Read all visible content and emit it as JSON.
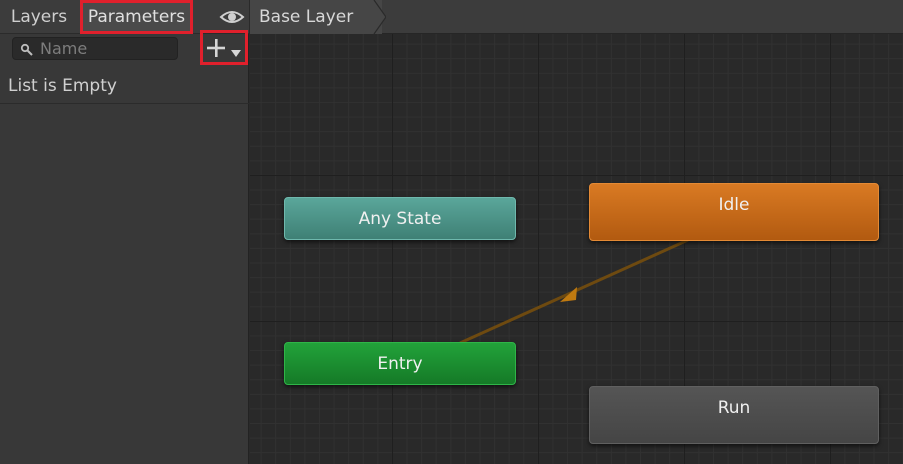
{
  "tabs": {
    "layers_label": "Layers",
    "parameters_label": "Parameters"
  },
  "search": {
    "placeholder": "Name",
    "value": ""
  },
  "parameters_list": {
    "empty_text": "List is Empty"
  },
  "breadcrumb": {
    "layer": "Base Layer"
  },
  "states": {
    "any_state": "Any State",
    "idle": "Idle",
    "entry": "Entry",
    "run": "Run"
  },
  "icons": {
    "visibility": "eye-icon",
    "search": "search-icon",
    "add": "plus-icon",
    "dropdown": "dropdown-arrow-icon"
  },
  "colors": {
    "highlight": "#e0202c",
    "any_state": "#4f9a8e",
    "idle": "#c8691a",
    "entry": "#1c8e32",
    "run": "#4d4d4d",
    "transition": "#6e4a10"
  }
}
